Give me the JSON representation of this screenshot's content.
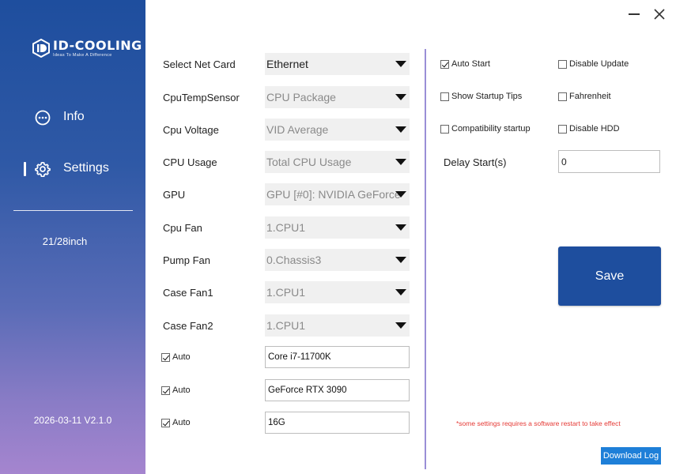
{
  "sidebar": {
    "logo_text": "ID-COOLING",
    "logo_tagline": "Ideas To Make A Difference",
    "nav": [
      {
        "label": "Info",
        "icon": "dots-circle-icon"
      },
      {
        "label": "Settings",
        "icon": "gear-icon",
        "active": true
      }
    ],
    "screen_size": "21/28inch",
    "version": "2026-03-11 V2.1.0"
  },
  "form": {
    "rows": [
      {
        "label": "Select Net Card",
        "value": "Ethernet",
        "active": true
      },
      {
        "label": "CpuTempSensor",
        "value": "CPU Package"
      },
      {
        "label": "Cpu Voltage",
        "value": "VID Average"
      },
      {
        "label": "CPU Usage",
        "value": "Total CPU Usage"
      },
      {
        "label": "GPU",
        "value": "GPU [#0]: NVIDIA GeForce"
      },
      {
        "label": "Cpu Fan",
        "value": "1.CPU1"
      },
      {
        "label": "Pump Fan",
        "value": "0.Chassis3"
      },
      {
        "label": "Case Fan1",
        "value": "1.CPU1"
      },
      {
        "label": "Case Fan2",
        "value": "1.CPU1"
      }
    ],
    "auto_rows": [
      {
        "label": "Auto",
        "checked": true,
        "value": "Core i7-11700K"
      },
      {
        "label": "Auto",
        "checked": true,
        "value": "GeForce RTX 3090"
      },
      {
        "label": "Auto",
        "checked": true,
        "value": "16G"
      }
    ]
  },
  "options": {
    "auto_start": {
      "label": "Auto Start",
      "checked": true
    },
    "disable_update": {
      "label": "Disable Update",
      "checked": false
    },
    "show_startup_tips": {
      "label": "Show Startup Tips",
      "checked": false
    },
    "fahrenheit": {
      "label": "Fahrenheit",
      "checked": false
    },
    "compatibility_startup": {
      "label": "Compatibility startup",
      "checked": false
    },
    "disable_hdd": {
      "label": "Disable HDD",
      "checked": false
    },
    "delay_label": "Delay Start(s)",
    "delay_value": "0"
  },
  "actions": {
    "save_label": "Save",
    "restart_note": "*some settings requires a software restart to take effect",
    "download_label": "Download Log"
  },
  "colors": {
    "brand_blue": "#1e4e9e",
    "download_blue": "#1e7fd8",
    "warning_red": "#e53935",
    "separator": "#9a8fd6"
  }
}
